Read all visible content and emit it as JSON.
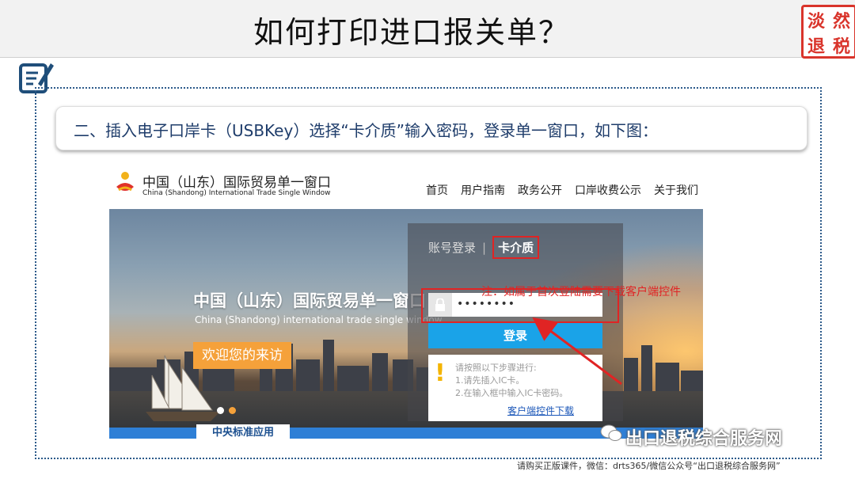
{
  "slide": {
    "title": "如何打印进口报关单？",
    "seal": [
      "淡",
      "然",
      "退",
      "税"
    ],
    "subheading": "二、插入电子口岸卡（USBKey）选择“卡介质”输入密码，登录单一窗口，如下图："
  },
  "site": {
    "name_cn": "中国（山东）国际贸易单一窗口",
    "name_en": "China (Shandong) International Trade Single Window",
    "nav": [
      "首页",
      "用户指南",
      "政务公开",
      "口岸收费公示",
      "关于我们"
    ]
  },
  "hero": {
    "title_cn": "中国（山东）国际贸易单一窗口",
    "title_en": "China (Shandong) international trade single window",
    "welcome": "欢迎您的来访",
    "bottom_tab": "中央标准应用"
  },
  "login": {
    "tab_account": "账号登录",
    "tab_card": "卡介质",
    "password_value": "••••••••",
    "button": "登录",
    "tips": [
      "请按照以下步骤进行:",
      "1.请先插入IC卡。",
      "2.在输入框中输入IC卡密码。"
    ],
    "download_link": "客户端控件下载"
  },
  "annotation": {
    "note": "注：如属于首次登陆需要下载客户端控件"
  },
  "watermark": "出口退税综合服务网",
  "footer": "请购买正版课件，微信：drts365/微信公众号“出口退税综合服务网”",
  "colors": {
    "accent_red": "#e02424",
    "login_blue": "#1aa3e8",
    "brand_blue": "#2e7fd6",
    "welcome_orange": "#f5a13a"
  }
}
